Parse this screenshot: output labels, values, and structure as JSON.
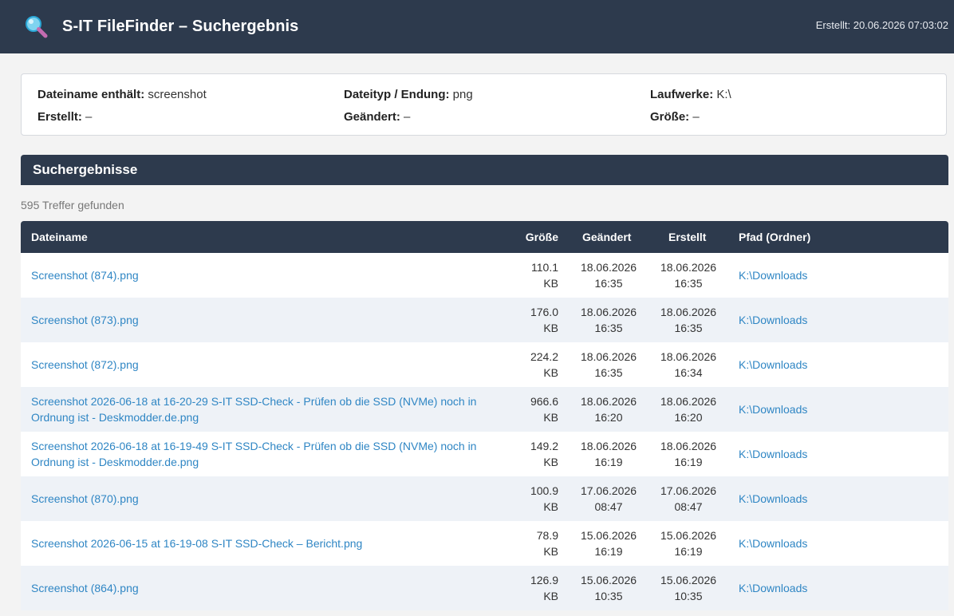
{
  "header": {
    "title": "S-IT FileFinder – Suchergebnis",
    "created": "Erstellt: 20.06.2026 07:03:02",
    "icon": "magnifier-icon"
  },
  "criteria": {
    "name_label": "Dateiname enthält:",
    "name_value": " screenshot",
    "type_label": "Dateityp / Endung:",
    "type_value": " png",
    "drives_label": "Laufwerke:",
    "drives_value": " K:\\",
    "created_label": "Erstellt:",
    "created_value": " –",
    "modified_label": "Geändert:",
    "modified_value": " –",
    "size_label": "Größe:",
    "size_value": " –"
  },
  "results": {
    "section_title": "Suchergebnisse",
    "count": "595 Treffer gefunden",
    "columns": {
      "name": "Dateiname",
      "size": "Größe",
      "modified": "Geändert",
      "created": "Erstellt",
      "path": "Pfad (Ordner)"
    },
    "rows": [
      {
        "name": "Screenshot (874).png",
        "size": "110.1",
        "unit": "KB",
        "mod_date": "18.06.2026",
        "mod_time": "16:35",
        "cre_date": "18.06.2026",
        "cre_time": "16:35",
        "path": "K:\\Downloads"
      },
      {
        "name": "Screenshot (873).png",
        "size": "176.0",
        "unit": "KB",
        "mod_date": "18.06.2026",
        "mod_time": "16:35",
        "cre_date": "18.06.2026",
        "cre_time": "16:35",
        "path": "K:\\Downloads"
      },
      {
        "name": "Screenshot (872).png",
        "size": "224.2",
        "unit": "KB",
        "mod_date": "18.06.2026",
        "mod_time": "16:35",
        "cre_date": "18.06.2026",
        "cre_time": "16:34",
        "path": "K:\\Downloads"
      },
      {
        "name": "Screenshot 2026-06-18 at 16-20-29 S-IT SSD-Check - Prüfen ob die SSD (NVMe) noch in Ordnung ist - Deskmodder.de.png",
        "size": "966.6",
        "unit": "KB",
        "mod_date": "18.06.2026",
        "mod_time": "16:20",
        "cre_date": "18.06.2026",
        "cre_time": "16:20",
        "path": "K:\\Downloads"
      },
      {
        "name": "Screenshot 2026-06-18 at 16-19-49 S-IT SSD-Check - Prüfen ob die SSD (NVMe) noch in Ordnung ist - Deskmodder.de.png",
        "size": "149.2",
        "unit": "KB",
        "mod_date": "18.06.2026",
        "mod_time": "16:19",
        "cre_date": "18.06.2026",
        "cre_time": "16:19",
        "path": "K:\\Downloads"
      },
      {
        "name": "Screenshot (870).png",
        "size": "100.9",
        "unit": "KB",
        "mod_date": "17.06.2026",
        "mod_time": "08:47",
        "cre_date": "17.06.2026",
        "cre_time": "08:47",
        "path": "K:\\Downloads"
      },
      {
        "name": "Screenshot 2026-06-15 at 16-19-08 S-IT SSD-Check – Bericht.png",
        "size": "78.9",
        "unit": "KB",
        "mod_date": "15.06.2026",
        "mod_time": "16:19",
        "cre_date": "15.06.2026",
        "cre_time": "16:19",
        "path": "K:\\Downloads"
      },
      {
        "name": "Screenshot (864).png",
        "size": "126.9",
        "unit": "KB",
        "mod_date": "15.06.2026",
        "mod_time": "10:35",
        "cre_date": "15.06.2026",
        "cre_time": "10:35",
        "path": "K:\\Downloads"
      }
    ]
  }
}
